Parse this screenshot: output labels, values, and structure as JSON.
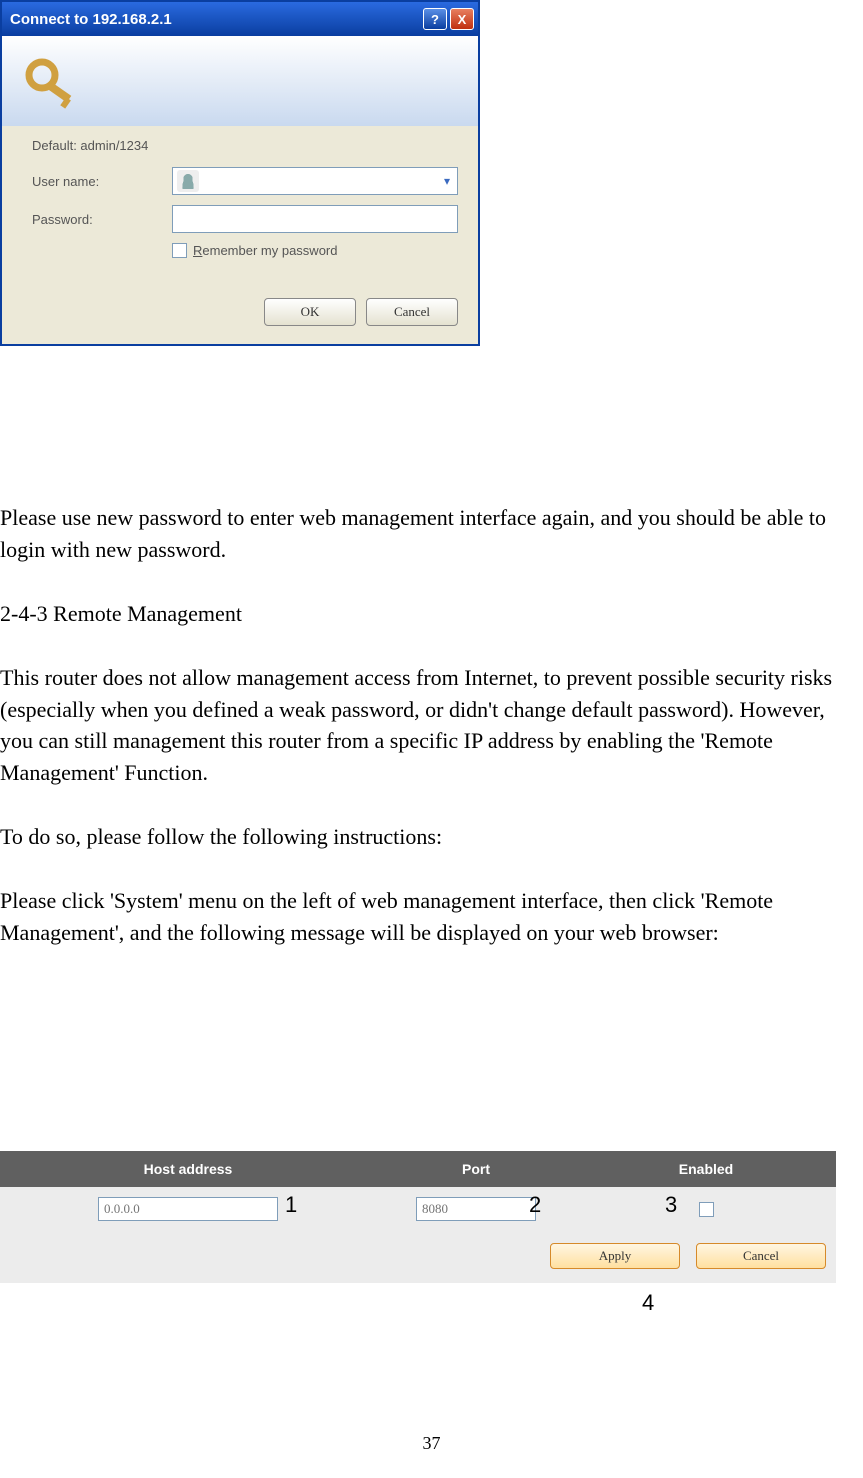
{
  "xp_dialog": {
    "title": "Connect to 192.168.2.1",
    "help_symbol": "?",
    "close_symbol": "X",
    "default_cred": "Default: admin/1234",
    "user_label": "User name:",
    "user_value": "",
    "pwd_label": "Password:",
    "remember_r": "R",
    "remember_rest": "emember my password",
    "ok": "OK",
    "cancel": "Cancel",
    "drop_glyph": "▾"
  },
  "doc": {
    "p1": "Please use new password to enter web management interface again, and you should be able to login with new password.",
    "h1": "2-4-3 Remote Management",
    "p2": "This router does not allow management access from Internet, to prevent possible security risks (especially when you defined a weak password, or didn't change default password). However, you can still management this router from a specific IP address by enabling the 'Remote Management' Function.",
    "p3": "To do so, please follow the following instructions:",
    "p4": "Please click 'System' menu on the left of web management interface, then click 'Remote Management', and the following message will be displayed on your web browser:"
  },
  "rm": {
    "header": {
      "host": "Host address",
      "port": "Port",
      "enabled": "Enabled"
    },
    "host_ph": "0.0.0.0",
    "port_ph": "8080",
    "apply": "Apply",
    "cancel": "Cancel"
  },
  "callouts": {
    "c1": "1",
    "c2": "2",
    "c3": "3",
    "c4": "4"
  },
  "page_number": "37"
}
